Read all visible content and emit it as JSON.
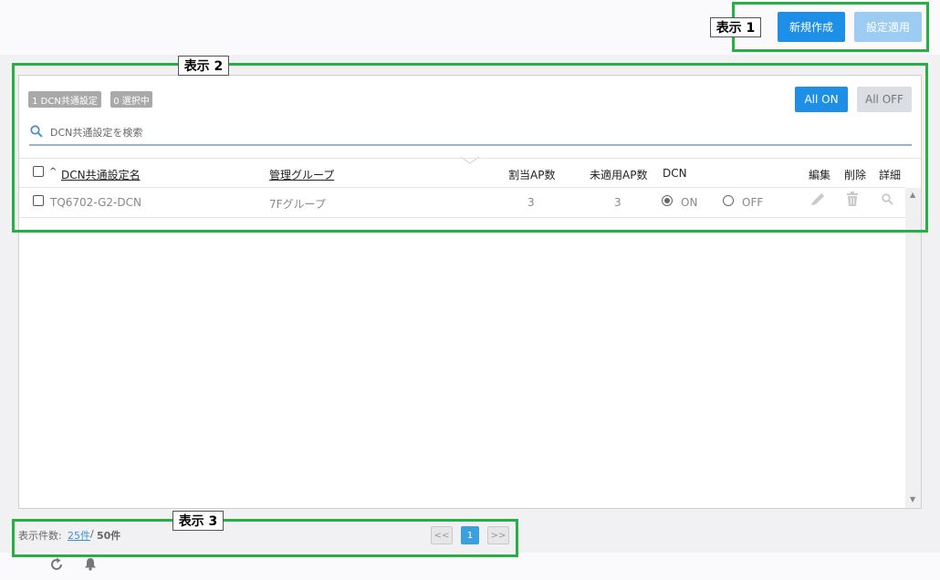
{
  "header": {
    "new_button": "新規作成",
    "apply_button": "設定適用"
  },
  "annotations": {
    "label1": "表示 1",
    "label2": "表示 2",
    "label3": "表示 3"
  },
  "toolbar": {
    "count_badge": "1  DCN共通設定",
    "selected_badge": "0 選択中",
    "all_on": "All ON",
    "all_off": "All OFF",
    "search_placeholder": "DCN共通設定を検索"
  },
  "table": {
    "sort_indicator": "^",
    "headers": {
      "name": "DCN共通設定名",
      "group": "管理グループ",
      "assigned_ap": "割当AP数",
      "unapplied_ap": "未適用AP数",
      "dcn": "DCN",
      "edit": "編集",
      "delete": "削除",
      "detail": "詳細"
    },
    "rows": [
      {
        "name": "TQ6702-G2-DCN",
        "group": "7Fグループ",
        "assigned_ap": "3",
        "unapplied_ap": "3",
        "dcn_on_label": "ON",
        "dcn_off_label": "OFF",
        "dcn_value": "ON"
      }
    ]
  },
  "footer": {
    "display_label": "表示件数:",
    "per_page": "25件",
    "separator": "/",
    "total": "50件",
    "prev": "<<",
    "current_page": "1",
    "next": ">>"
  },
  "colors": {
    "primary": "#1e8fe6",
    "primary_disabled": "#9cccf2",
    "annotation_green": "#27ae45"
  }
}
